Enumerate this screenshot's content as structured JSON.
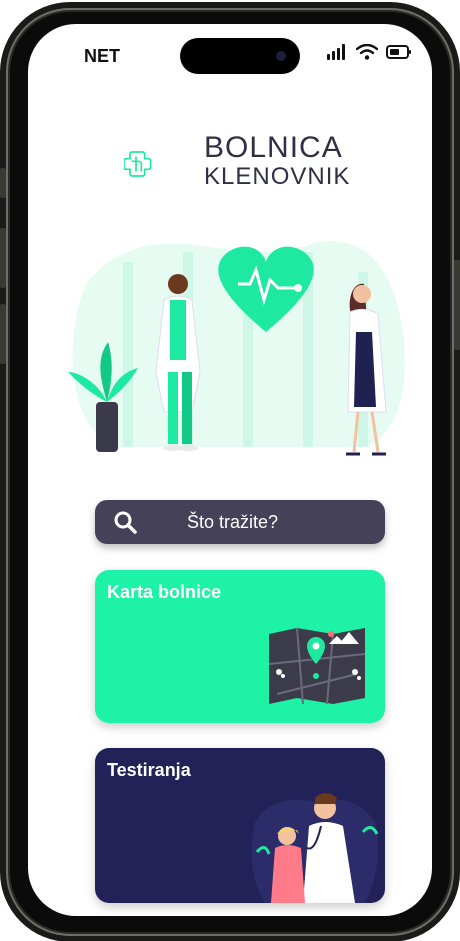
{
  "status_bar": {
    "carrier": "NET"
  },
  "logo": {
    "line1": "BOLNICA",
    "line2": "KLENOVNIK"
  },
  "search": {
    "placeholder": "Što tražite?"
  },
  "cards": [
    {
      "title": "Karta bolnice",
      "color": "#1df2a6"
    },
    {
      "title": "Testiranja",
      "color": "#222258"
    }
  ],
  "colors": {
    "accent": "#1df2a6",
    "dark": "#2f2f45",
    "search_bg": "#454158"
  }
}
